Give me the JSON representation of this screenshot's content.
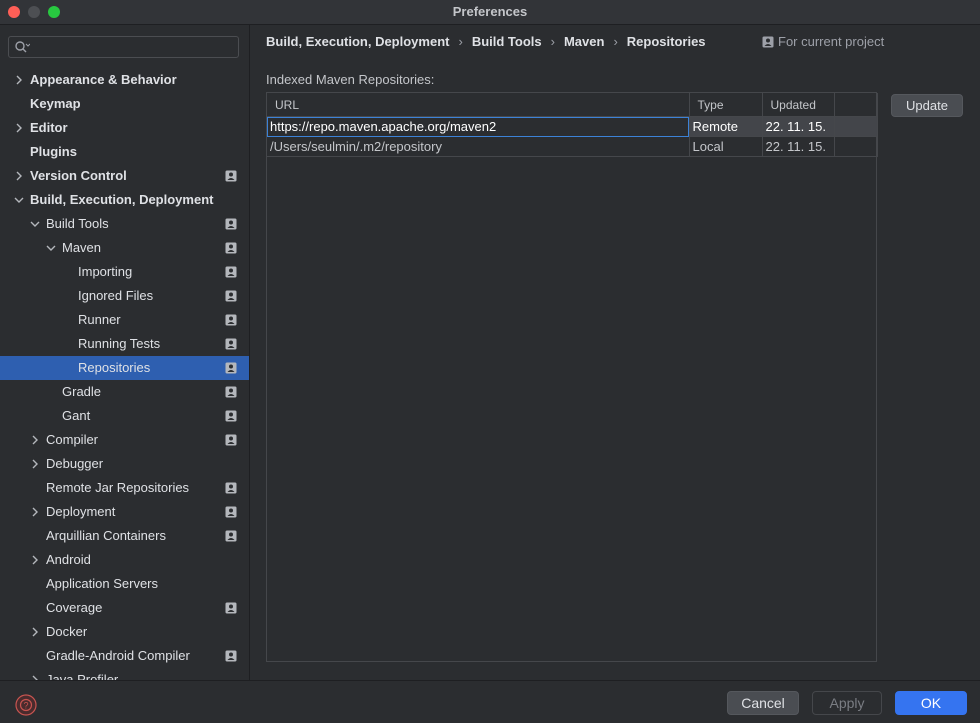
{
  "window": {
    "title": "Preferences"
  },
  "search": {
    "placeholder": "",
    "value": ""
  },
  "tree": [
    {
      "label": "Appearance & Behavior",
      "bold": true,
      "chevron": "right",
      "indent": 0,
      "project": false
    },
    {
      "label": "Keymap",
      "bold": true,
      "chevron": "none",
      "indent": 0,
      "project": false
    },
    {
      "label": "Editor",
      "bold": true,
      "chevron": "right",
      "indent": 0,
      "project": false
    },
    {
      "label": "Plugins",
      "bold": true,
      "chevron": "none",
      "indent": 0,
      "project": false
    },
    {
      "label": "Version Control",
      "bold": true,
      "chevron": "right",
      "indent": 0,
      "project": true
    },
    {
      "label": "Build, Execution, Deployment",
      "bold": true,
      "chevron": "down",
      "indent": 0,
      "project": false
    },
    {
      "label": "Build Tools",
      "bold": false,
      "chevron": "down",
      "indent": 1,
      "project": true
    },
    {
      "label": "Maven",
      "bold": false,
      "chevron": "down",
      "indent": 2,
      "project": true
    },
    {
      "label": "Importing",
      "bold": false,
      "chevron": "none",
      "indent": 3,
      "project": true
    },
    {
      "label": "Ignored Files",
      "bold": false,
      "chevron": "none",
      "indent": 3,
      "project": true
    },
    {
      "label": "Runner",
      "bold": false,
      "chevron": "none",
      "indent": 3,
      "project": true
    },
    {
      "label": "Running Tests",
      "bold": false,
      "chevron": "none",
      "indent": 3,
      "project": true
    },
    {
      "label": "Repositories",
      "bold": false,
      "chevron": "none",
      "indent": 3,
      "project": true,
      "selected": true
    },
    {
      "label": "Gradle",
      "bold": false,
      "chevron": "none",
      "indent": 2,
      "project": true
    },
    {
      "label": "Gant",
      "bold": false,
      "chevron": "none",
      "indent": 2,
      "project": true
    },
    {
      "label": "Compiler",
      "bold": false,
      "chevron": "right",
      "indent": 1,
      "project": true
    },
    {
      "label": "Debugger",
      "bold": false,
      "chevron": "right",
      "indent": 1,
      "project": false
    },
    {
      "label": "Remote Jar Repositories",
      "bold": false,
      "chevron": "none",
      "indent": 1,
      "project": true
    },
    {
      "label": "Deployment",
      "bold": false,
      "chevron": "right",
      "indent": 1,
      "project": true
    },
    {
      "label": "Arquillian Containers",
      "bold": false,
      "chevron": "none",
      "indent": 1,
      "project": true
    },
    {
      "label": "Android",
      "bold": false,
      "chevron": "right",
      "indent": 1,
      "project": false
    },
    {
      "label": "Application Servers",
      "bold": false,
      "chevron": "none",
      "indent": 1,
      "project": false
    },
    {
      "label": "Coverage",
      "bold": false,
      "chevron": "none",
      "indent": 1,
      "project": true
    },
    {
      "label": "Docker",
      "bold": false,
      "chevron": "right",
      "indent": 1,
      "project": false
    },
    {
      "label": "Gradle-Android Compiler",
      "bold": false,
      "chevron": "none",
      "indent": 1,
      "project": true
    },
    {
      "label": "Java Profiler",
      "bold": false,
      "chevron": "right",
      "indent": 1,
      "project": false
    }
  ],
  "breadcrumb": [
    "Build, Execution, Deployment",
    "Build Tools",
    "Maven",
    "Repositories"
  ],
  "scope_label": "For current project",
  "section_label": "Indexed Maven Repositories:",
  "table": {
    "columns": [
      "URL",
      "Type",
      "Updated",
      ""
    ],
    "rows": [
      {
        "url": "https://repo.maven.apache.org/maven2",
        "type": "Remote",
        "updated": "22. 11. 15.",
        "extra": "",
        "selected": true
      },
      {
        "url": "/Users/seulmin/.m2/repository",
        "type": "Local",
        "updated": "22. 11. 15.",
        "extra": "",
        "selected": false
      }
    ]
  },
  "update_button": "Update",
  "footer": {
    "cancel": "Cancel",
    "apply": "Apply",
    "ok": "OK"
  },
  "colors": {
    "accent": "#3574f0",
    "selection": "#2e5fb0",
    "background": "#2b2d30"
  }
}
